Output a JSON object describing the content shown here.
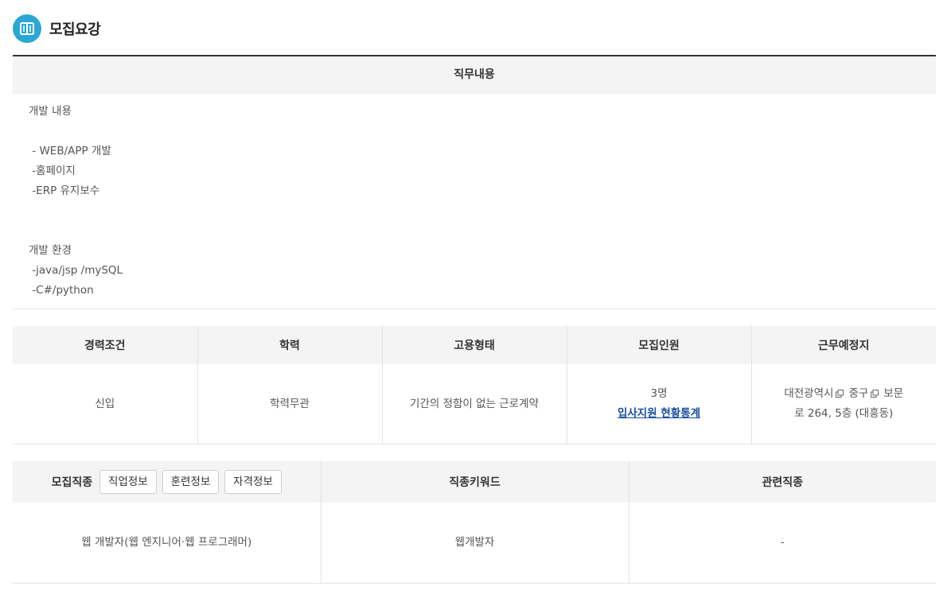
{
  "header": {
    "title": "모집요강",
    "icon": "book-icon",
    "icon_color": "#2aa7d3"
  },
  "job_content": {
    "heading": "직무내용",
    "lines": [
      "개발 내용",
      "",
      " - WEB/APP 개발",
      " -홈페이지",
      " -ERP 유지보수",
      "",
      "",
      "개발 환경",
      " -java/jsp /mySQL",
      " -C#/python"
    ]
  },
  "conditions": {
    "headers": [
      "경력조건",
      "학력",
      "고용형태",
      "모집인원",
      "근무예정지"
    ],
    "experience": "신입",
    "education": "학력무관",
    "employment_type": "기간의 정함이 없는 근로계약",
    "headcount": "3명",
    "stats_link": "입사지원 현황통계",
    "location": {
      "city": "대전광역시",
      "district": "중구",
      "street_a": "보문",
      "street_b": "로 264, 5층 (대흥동)"
    }
  },
  "occupation": {
    "header_label": "모집직종",
    "buttons": [
      "직업정보",
      "훈련정보",
      "자격정보"
    ],
    "keyword_header": "직종키워드",
    "related_header": "관련직종",
    "job_name": "웹 개발자(웹 엔지니어·웹 프로그래머)",
    "keyword": "웹개발자",
    "related": "-"
  }
}
